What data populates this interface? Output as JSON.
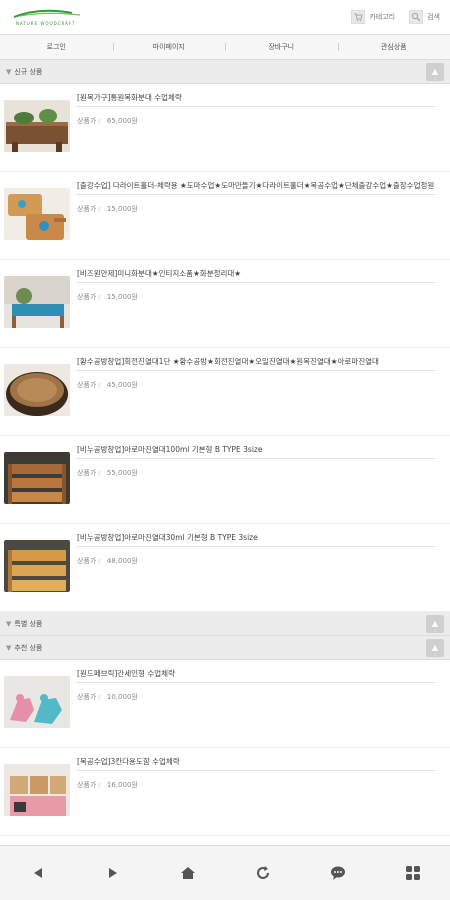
{
  "header": {
    "logo_text": "NATURE WOODCRAFT",
    "cart_label": "카테고리",
    "search_label": "검색"
  },
  "nav": [
    {
      "label": "로그인"
    },
    {
      "label": "마이페이지"
    },
    {
      "label": "장바구니"
    },
    {
      "label": "관심상품"
    }
  ],
  "sections": {
    "new": {
      "title": "신규 상품"
    },
    "special": {
      "title": "특별 상품"
    },
    "recommend": {
      "title": "추천 상품"
    }
  },
  "price_label": "상품가 :",
  "new_products": [
    {
      "title": "[원목가구]통원목화분대 수업체략",
      "price": "65,000원"
    },
    {
      "title": "[출강수업] 다라이트홀더-체략용 ★도마수업★도마만들기★다라이트홀더★목공수업★단체출강수업★출장수업정원",
      "price": "15,000원"
    },
    {
      "title": "[비즈원안제]미니화분대★인티지소품★화분정리대★",
      "price": "15,000원"
    },
    {
      "title": "[황수공방창업]회전진열대1단 ★황수공방★회전진열대★오일진열대★원목진열대★아로마진열대",
      "price": "45,000원"
    },
    {
      "title": "[비누공방창업]아로마진열대100ml 기본형 B TYPE 3size",
      "price": "55,000원"
    },
    {
      "title": "[비누공방창업]아로마진열대30ml 기본형 B TYPE 3size",
      "price": "48,000원"
    }
  ],
  "recommend_products": [
    {
      "title": "[원드페브릭]간세인형 수업체략",
      "price": "10,000원"
    },
    {
      "title": "[목공수업]3칸다용도함 수업체략",
      "price": "16,000원"
    }
  ],
  "bottom_bar": [
    "back-icon",
    "forward-icon",
    "home-icon",
    "refresh-icon",
    "chat-icon",
    "grid-menu-icon"
  ]
}
